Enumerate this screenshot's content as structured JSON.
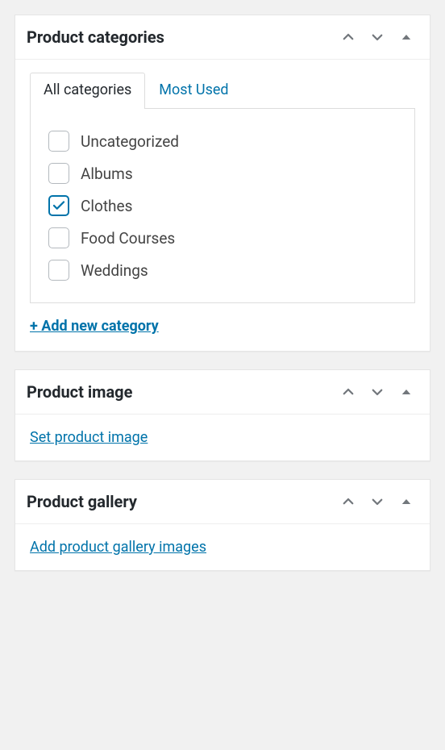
{
  "panels": {
    "categories": {
      "title": "Product categories",
      "tabs": [
        {
          "label": "All categories",
          "active": true
        },
        {
          "label": "Most Used",
          "active": false
        }
      ],
      "items": [
        {
          "label": "Uncategorized",
          "checked": false
        },
        {
          "label": "Albums",
          "checked": false
        },
        {
          "label": "Clothes",
          "checked": true
        },
        {
          "label": "Food Courses",
          "checked": false
        },
        {
          "label": "Weddings",
          "checked": false
        }
      ],
      "add_link": "+ Add new category"
    },
    "image": {
      "title": "Product image",
      "set_link": "Set product image"
    },
    "gallery": {
      "title": "Product gallery",
      "add_link": "Add product gallery images"
    }
  }
}
